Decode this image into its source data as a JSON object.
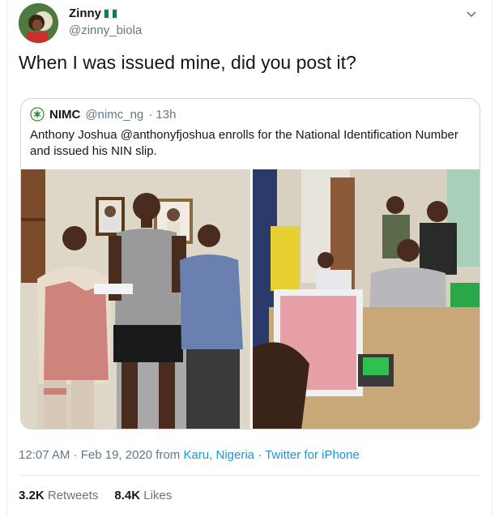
{
  "tweet": {
    "author": {
      "display_name": "Zinny",
      "handle": "@zinny_biola"
    },
    "text": "When I was issued mine, did you post it?",
    "timestamp": "12:07 AM · Feb 19, 2020",
    "from_label": "from",
    "location": "Karu, Nigeria",
    "separator": "·",
    "source": "Twitter for iPhone",
    "retweets": {
      "count": "3.2K",
      "label": "Retweets"
    },
    "likes": {
      "count": "8.4K",
      "label": "Likes"
    }
  },
  "quoted_tweet": {
    "author": {
      "display_name": "NIMC",
      "handle": "@nimc_ng",
      "time": "· 13h"
    },
    "text": "Anthony Joshua @anthonyfjoshua enrolls for the National Identification Number and issued his NIN slip."
  },
  "colors": {
    "accent": "#1b95e0",
    "flag_green": "#008751",
    "muted": "#657786"
  },
  "icons": {
    "caret": "chevron-down-icon",
    "nimc_logo": "nimc-logo-icon"
  }
}
